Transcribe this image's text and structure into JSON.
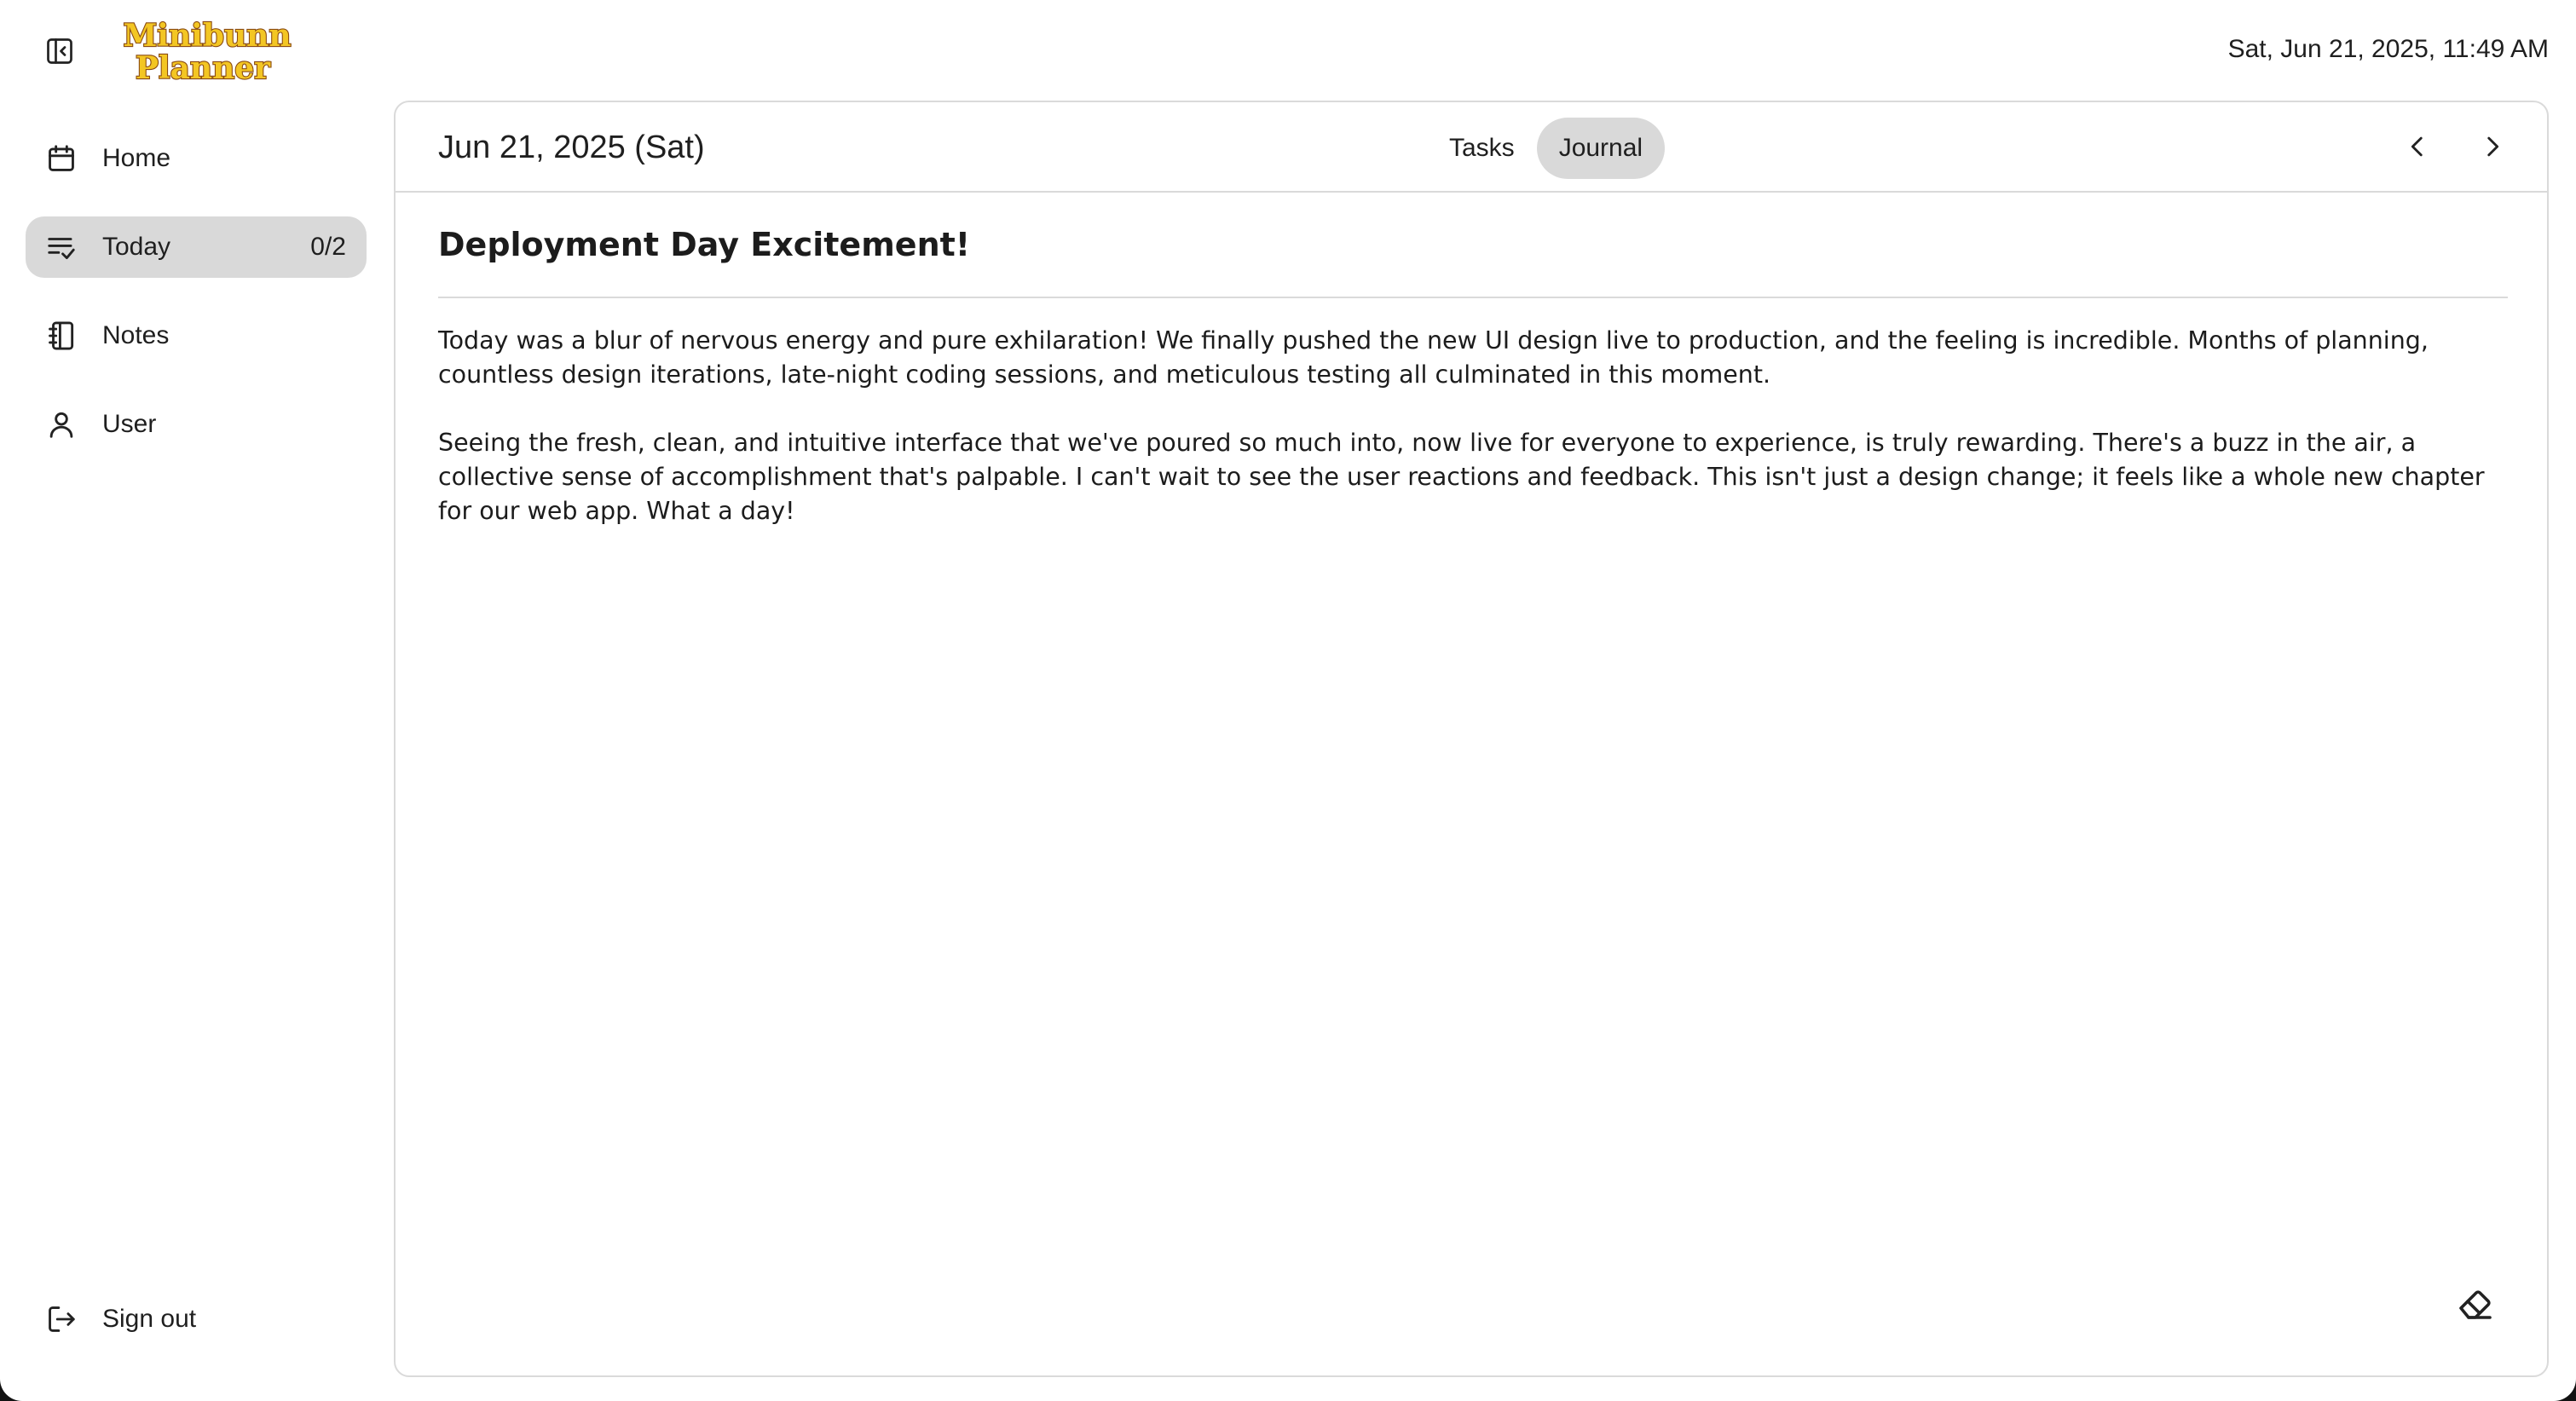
{
  "app": {
    "logo_line1": "Minibunn",
    "logo_line2": "Planner",
    "datetime": "Sat, Jun 21, 2025, 11:49 AM"
  },
  "sidebar": {
    "items": [
      {
        "label": "Home",
        "icon": "calendar-icon"
      },
      {
        "label": "Today",
        "icon": "checklist-icon",
        "count": "0/2"
      },
      {
        "label": "Notes",
        "icon": "notebook-icon"
      },
      {
        "label": "User",
        "icon": "user-icon"
      }
    ],
    "signout": {
      "label": "Sign out",
      "icon": "sign-out-icon"
    }
  },
  "main": {
    "date": "Jun 21, 2025 (Sat)",
    "tabs": [
      {
        "label": "Tasks",
        "active": false
      },
      {
        "label": "Journal",
        "active": true
      }
    ],
    "journal": {
      "title": "Deployment Day Excitement!",
      "paragraphs": [
        "Today was a blur of nervous energy and pure exhilaration! We finally pushed the new UI design live to production, and the feeling is incredible. Months of planning, countless design iterations, late-night coding sessions, and meticulous testing all culminated in this moment.",
        "Seeing the fresh, clean, and intuitive interface that we've poured so much into, now live for everyone to experience, is truly rewarding. There's a buzz in the air, a collective sense of accomplishment that's palpable. I can't wait to see the user reactions and feedback. This isn't just a design change; it feels like a whole new chapter for our web app. What a day!"
      ]
    }
  },
  "colors": {
    "active_bg": "#d9d9d9",
    "border": "#dadada",
    "logo_fill": "#f3c623",
    "logo_stroke": "#8a4b12"
  }
}
